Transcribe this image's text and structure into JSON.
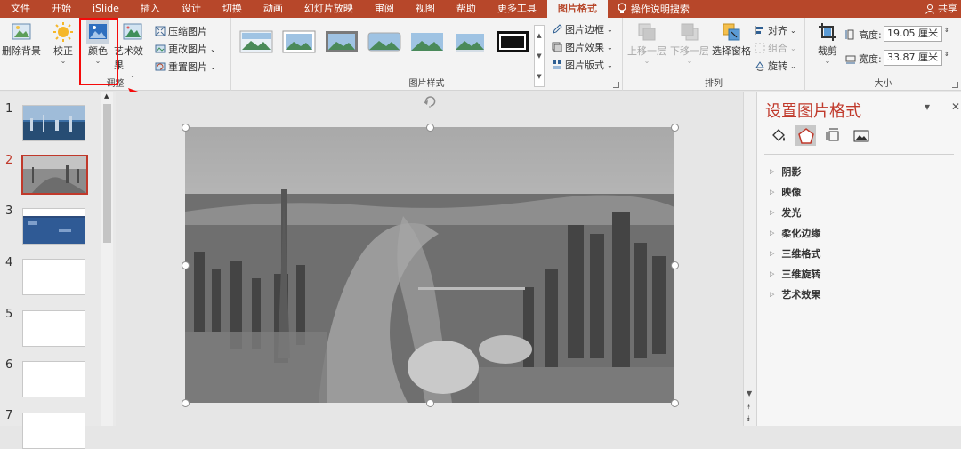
{
  "menu": {
    "tabs": [
      "文件",
      "开始",
      "iSlide",
      "插入",
      "设计",
      "切换",
      "动画",
      "幻灯片放映",
      "审阅",
      "视图",
      "帮助",
      "更多工具",
      "图片格式"
    ],
    "active_tab": "图片格式",
    "search_label": "操作说明搜索",
    "share_label": "共享"
  },
  "ribbon": {
    "adjust": {
      "remove_bg": "删除背景",
      "correct": "校正",
      "color": "颜色",
      "artistic": "艺术效果",
      "compress": "压缩图片",
      "change": "更改图片",
      "reset": "重置图片",
      "label": "调整"
    },
    "styles": {
      "label": "图片样式",
      "border": "图片边框",
      "effects": "图片效果",
      "layout": "图片版式"
    },
    "arrange": {
      "label": "排列",
      "bring_forward": "上移一层",
      "send_backward": "下移一层",
      "selection_pane": "选择窗格",
      "align": "对齐",
      "group": "组合",
      "rotate": "旋转"
    },
    "size": {
      "label": "大小",
      "crop": "裁剪",
      "height_label": "高度:",
      "height_value": "19.05 厘米",
      "width_label": "宽度:",
      "width_value": "33.87 厘米"
    }
  },
  "slides": {
    "numbers": [
      "1",
      "2",
      "3",
      "4",
      "5",
      "6",
      "7"
    ],
    "selected": 2
  },
  "format_pane": {
    "title": "设置图片格式",
    "properties": [
      "阴影",
      "映像",
      "发光",
      "柔化边缘",
      "三维格式",
      "三维旋转",
      "艺术效果"
    ]
  },
  "colors": {
    "accent": "#b7472a",
    "highlight": "#f50a0a"
  }
}
